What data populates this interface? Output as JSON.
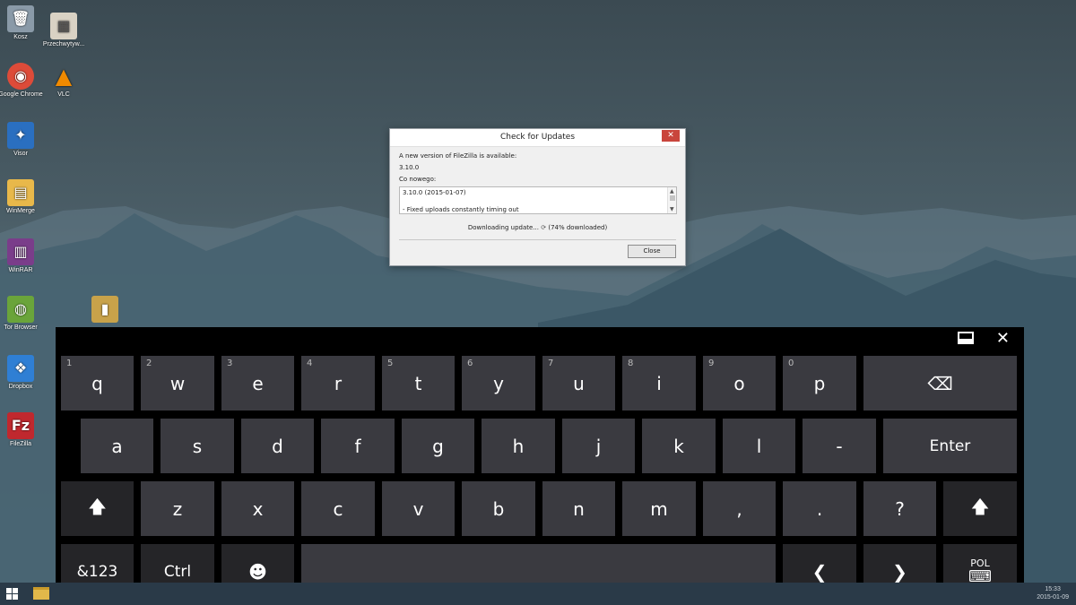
{
  "desktop": {
    "icons": [
      {
        "label": "Kosz",
        "icon": "recycle-bin-icon",
        "color": "#8a9aa8"
      },
      {
        "label": "Przechwytyw...",
        "icon": "folder-icon",
        "color": "#d9d2c4"
      },
      {
        "label": "Google Chrome",
        "icon": "chrome-icon",
        "color": "#dd4b39"
      },
      {
        "label": "VLC",
        "icon": "vlc-icon",
        "color": "#f08a00"
      },
      {
        "label": "Visor",
        "icon": "visor-icon",
        "color": "#2a6fc0"
      },
      {
        "label": "WinMerge",
        "icon": "winmerge-icon",
        "color": "#e8b84a"
      },
      {
        "label": "WinRAR",
        "icon": "winrar-icon",
        "color": "#7a3d8a"
      },
      {
        "label": "Tor Browser",
        "icon": "tor-icon",
        "color": "#6aa43a"
      },
      {
        "label": "",
        "icon": "folder-icon",
        "color": "#c8a24a"
      },
      {
        "label": "Dropbox",
        "icon": "dropbox-icon",
        "color": "#2f7fd4"
      },
      {
        "label": "FileZilla",
        "icon": "filezilla-icon",
        "color": "#c0282e"
      }
    ]
  },
  "dialog": {
    "title": "Check for Updates",
    "close_glyph": "✕",
    "available_text": "A new version of FileZilla is available:",
    "version": "3.10.0",
    "whats_new_label": "Co nowego:",
    "notes_line1": "3.10.0 (2015-01-07)",
    "notes_line2": "- Fixed uploads constantly timing out",
    "progress_text": "Downloading update...",
    "progress_percent_text": "(74% downloaded)",
    "progress_fraction": 0.74,
    "close_button": "Close"
  },
  "keyboard": {
    "row1": [
      {
        "num": "1",
        "label": "q"
      },
      {
        "num": "2",
        "label": "w"
      },
      {
        "num": "3",
        "label": "e"
      },
      {
        "num": "4",
        "label": "r"
      },
      {
        "num": "5",
        "label": "t"
      },
      {
        "num": "6",
        "label": "y"
      },
      {
        "num": "7",
        "label": "u"
      },
      {
        "num": "8",
        "label": "i"
      },
      {
        "num": "9",
        "label": "o"
      },
      {
        "num": "0",
        "label": "p"
      }
    ],
    "backspace": "⌫",
    "row2": [
      "a",
      "s",
      "d",
      "f",
      "g",
      "h",
      "j",
      "k",
      "l",
      "-"
    ],
    "enter": "Enter",
    "shift": "🡅",
    "row3": [
      "z",
      "x",
      "c",
      "v",
      "b",
      "n",
      "m",
      ",",
      ".",
      "?"
    ],
    "sym": "&123",
    "ctrl": "Ctrl",
    "emoji": "☻",
    "left": "❮",
    "right": "❯",
    "lang": "POL",
    "lang_icon": "⌨"
  },
  "taskbar": {
    "time": "15:33",
    "date": "2015-01-09"
  }
}
